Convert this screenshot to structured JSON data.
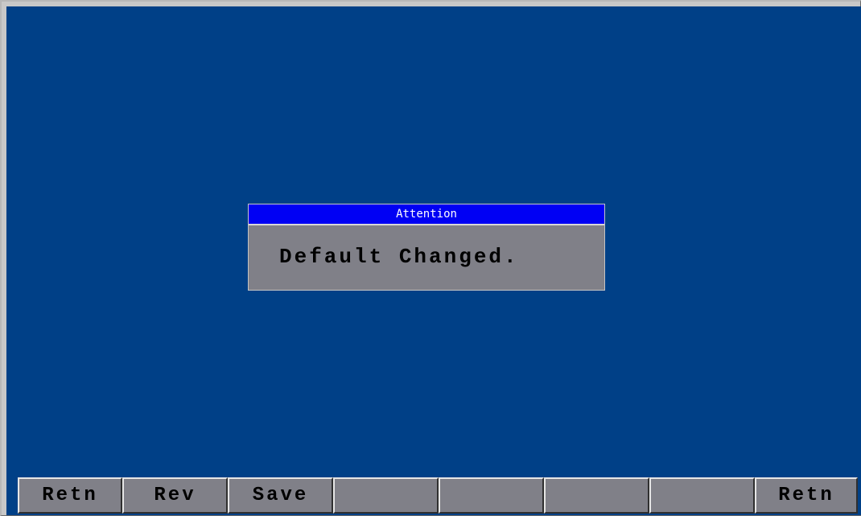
{
  "dialog": {
    "title": "Attention",
    "message": "Default Changed."
  },
  "function_keys": [
    {
      "label": "Retn"
    },
    {
      "label": "Rev"
    },
    {
      "label": "Save"
    },
    {
      "label": ""
    },
    {
      "label": ""
    },
    {
      "label": ""
    },
    {
      "label": ""
    },
    {
      "label": "Retn"
    }
  ],
  "colors": {
    "background": "#004087",
    "dialog_title_bar": "#0000f4",
    "dialog_body": "#808088",
    "key_face": "#808088"
  }
}
